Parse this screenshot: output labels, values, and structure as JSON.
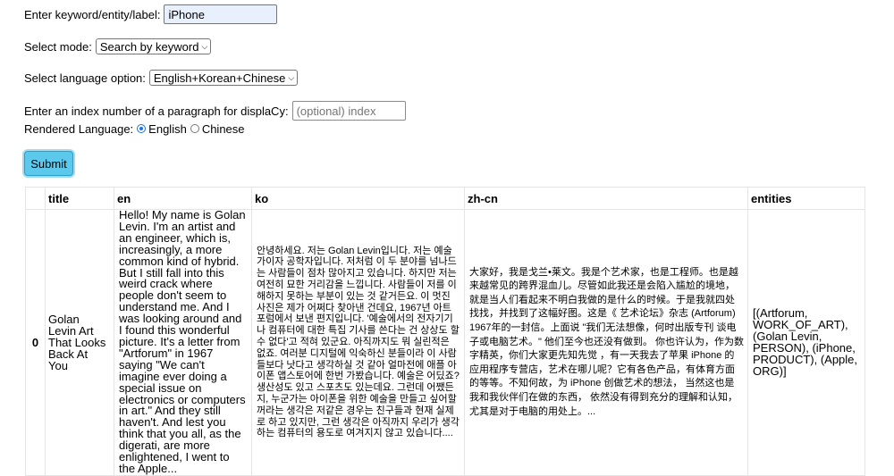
{
  "form": {
    "keyword_label": "Enter keyword/entity/label:",
    "keyword_value": "iPhone",
    "mode_label": "Select mode:",
    "mode_value": "Search by keyword",
    "language_label": "Select language option:",
    "language_value": "English+Korean+Chinese",
    "index_label": "Enter an index number of a paragraph for displaCy:",
    "index_placeholder": "(optional) index",
    "rendered_label": "Rendered Language:",
    "rendered_options": [
      "English",
      "Chinese"
    ],
    "rendered_selected": "English",
    "submit_label": "Submit"
  },
  "table": {
    "headers": [
      "",
      "title",
      "en",
      "ko",
      "zh-cn",
      "entities"
    ],
    "rows": [
      {
        "index": "0",
        "title": "Golan Levin Art That Looks Back At You",
        "en": "Hello! My name is Golan Levin. I'm an artist and an engineer, which is, increasingly, a more common kind of hybrid. But I still fall into this weird crack where people don't seem to understand me. And I was looking around and I found this wonderful picture. It's a letter from \"Artforum\" in 1967 saying \"We can't imagine ever doing a special issue on electronics or computers in art.\" And they still haven't. And lest you think that you all, as the digerati, are more enlightened, I went to the Apple...",
        "ko": "안녕하세요. 저는 Golan Levin입니다. 저는 예술가이자 공학자입니다. 저처럼 이 두 분야를 넘나드는 사람들이 점차 많아지고 있습니다. 하지만 저는 여전히 묘한 거리감을 느낍니다. 사람들이 저를 이해하지 못하는 부분이 있는 것 같거든요. 이 멋진 사진은 제가 어쩌다 찾아낸 건데요, 1967년 아트포럼에서 보낸 편지입니다. '예술에서의 전자기기나 컴퓨터에 대한 특집 기사를 쓴다는 건 상상도 할 수 없다'고 적혀 있군요. 아직까지도 뭐 실린적은 없죠. 여러분 디지털에 익숙하신 분들이라 이 사람들보다 낫다고 생각하실 것 같아 얼마전에 애플 아이폰 앱스토어에 한번 가봤습니다. 예술은 어딨죠? 생산성도 있고 스포츠도 있는데요. 그런데 어쨌든지, 누군가는 아이폰을 위한 예술을 만들고 싶어할 꺼라는 생각은 저같은 경우는 친구들과 현재 실제로 하고 있지만, 그런 생각은 아직까지 우리가 생각하는 컴퓨터의 용도로 여겨지지 않고 있습니다....",
        "zh": "大家好，我是戈兰•莱文。我是个艺术家，也是工程师。也是越来越常见的跨界混血儿。尽管如此我还是会陷入尴尬的境地， 就是当人们看起来不明白我做的是什么的时候。于是我就四处找找，并找到了这幅好图。这是《 艺术论坛》杂志 (Artforum) 1967年的一封信。上面说 \"我们无法想像，何时出版专刊 谈电子或电脑艺术。\" 他们至今也还没有做到。 你也许认为，作为数字精英，你们大家更先知先觉 ，有一天我去了苹果 iPhone 的应用程序专营店，艺术在哪儿呢？它有各色产品，有体育方面的等等。不知何故，为 iPhone 创做艺术的想法， 当然这也是我和我伙伴们在做的东西， 依然没有得到充分的理解和认知， 尤其是对于电脑的用处上。...",
        "entities": "[(Artforum, WORK_OF_ART), (Golan Levin, PERSON), (iPhone, PRODUCT), (Apple, ORG)]"
      }
    ]
  }
}
